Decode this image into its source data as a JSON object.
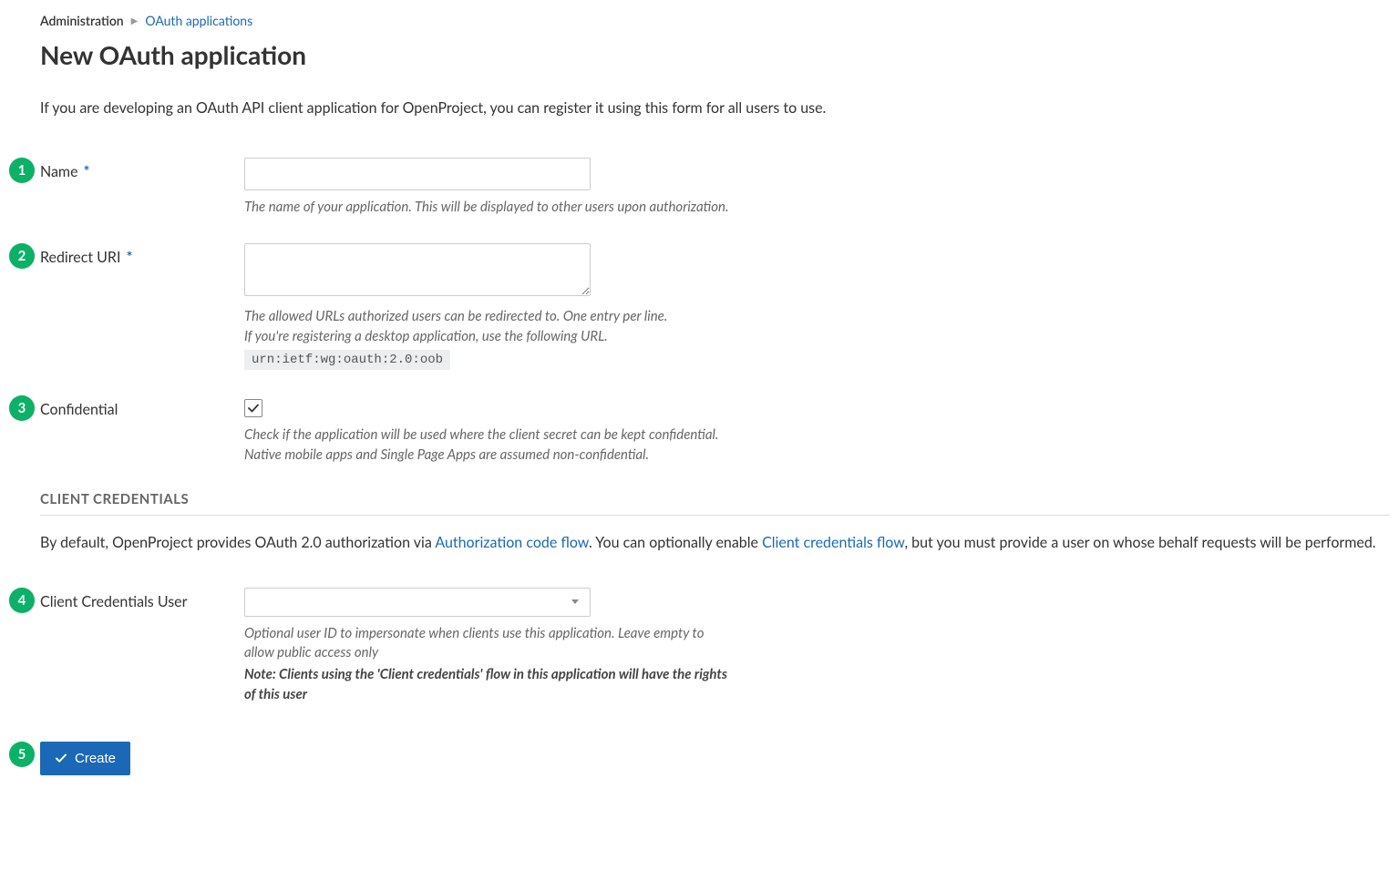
{
  "breadcrumb": {
    "root": "Administration",
    "current": "OAuth applications"
  },
  "page": {
    "title": "New OAuth application",
    "intro": "If you are developing an OAuth API client application for OpenProject, you can register it using this form for all users to use."
  },
  "callouts": [
    "1",
    "2",
    "3",
    "4",
    "5"
  ],
  "fields": {
    "name": {
      "label": "Name",
      "required": true,
      "help": "The name of your application. This will be displayed to other users upon authorization.",
      "value": ""
    },
    "redirect": {
      "label": "Redirect URI",
      "required": true,
      "help_line1": "The allowed URLs authorized users can be redirected to. One entry per line.",
      "help_line2": "If you're registering a desktop application, use the following URL.",
      "code": "urn:ietf:wg:oauth:2.0:oob",
      "value": ""
    },
    "confidential": {
      "label": "Confidential",
      "checked": true,
      "help": "Check if the application will be used where the client secret can be kept confidential. Native mobile apps and Single Page Apps are assumed non-confidential."
    },
    "client_credentials_user": {
      "label": "Client Credentials User",
      "help": "Optional user ID to impersonate when clients use this application. Leave empty to allow public access only",
      "note": "Note: Clients using the 'Client credentials' flow in this application will have the rights of this user",
      "value": ""
    }
  },
  "section": {
    "heading": "CLIENT CREDENTIALS",
    "desc_pre": "By default, OpenProject provides OAuth 2.0 authorization via ",
    "link1": "Authorization code flow",
    "desc_mid": ". You can optionally enable ",
    "link2": "Client credentials flow",
    "desc_post": ", but you must provide a user on whose behalf requests will be performed."
  },
  "buttons": {
    "create": "Create"
  }
}
